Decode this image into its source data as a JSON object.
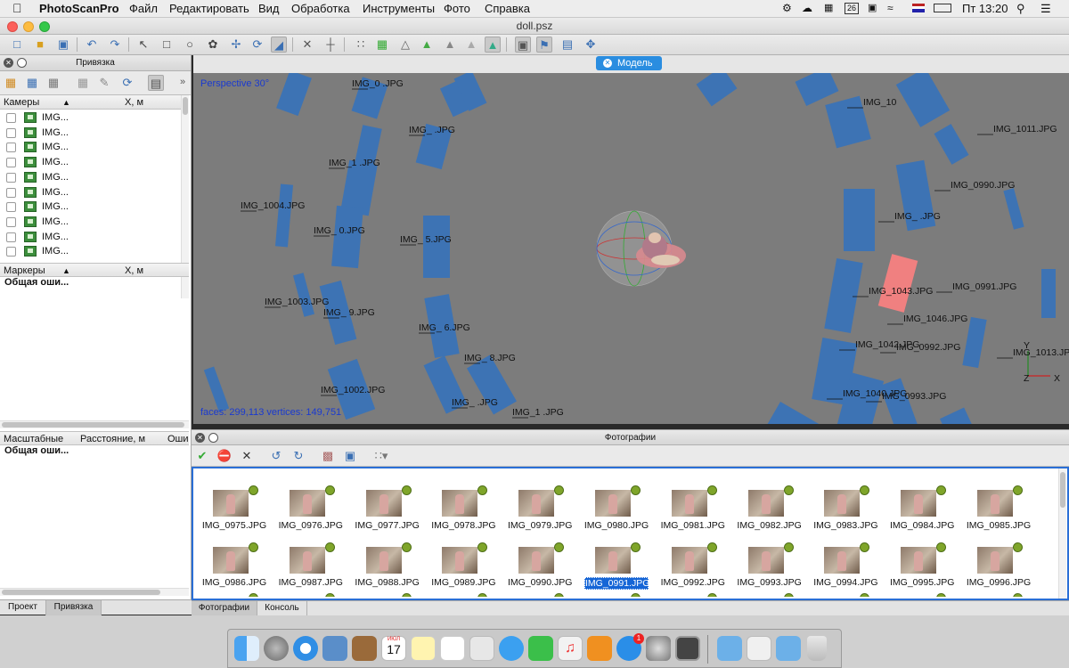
{
  "menubar": {
    "app": "PhotoScanPro",
    "items": [
      "Файл",
      "Редактировать",
      "Вид",
      "Обработка",
      "Инструменты",
      "Фото",
      "Справка"
    ],
    "battery_badge": "26",
    "clock": "Пт 13:20"
  },
  "window": {
    "title": "doll.psz"
  },
  "reference_panel": {
    "title": "Привязка",
    "cameras_col": "Камеры",
    "x_col": "X, м",
    "camera_rows": [
      "IMG...",
      "IMG...",
      "IMG...",
      "IMG...",
      "IMG...",
      "IMG...",
      "IMG...",
      "IMG...",
      "IMG...",
      "IMG..."
    ],
    "markers_col": "Маркеры",
    "markers_x_col": "X, м",
    "markers_total": "Общая оши...",
    "scale_col": "Масштабные",
    "scale_dist_col": "Расстояние, м",
    "scale_err_col": "Оши",
    "scale_total": "Общая оши...",
    "tabs": [
      "Проект",
      "Привязка"
    ]
  },
  "model_tab": {
    "label": "Модель"
  },
  "viewport": {
    "projection": "Perspective 30°",
    "stats": "faces: 299,113 vertices: 149,751",
    "axis_y": "Y",
    "axis_z": "Z",
    "axis_x": "X",
    "camera_labels": [
      "IMG_0  .JPG",
      "IMG_1  .JPG",
      "IMG_   .JPG",
      "IMG_1004.JPG",
      "IMG_   0.JPG",
      "IMG_  5.JPG",
      "IMG_1003.JPG",
      "IMG_  9.JPG",
      "IMG_  6.JPG",
      "IMG_   8.JPG",
      "IMG_1002.JPG",
      "IMG_   .JPG",
      "IMG_1  .JPG",
      "IMG_10  ",
      "IMG_1011.JPG",
      "IMG_0990.JPG",
      "IMG_   .JPG",
      "IMG_1043.JPG",
      "IMG_0991.JPG",
      "IMG_1046.JPG",
      "IMG_1042.JPG",
      "IMG_0992.JPG",
      "IMG_1013.JPG",
      "IMG_1040.JPG",
      "IMG_0993.JPG"
    ]
  },
  "photos_panel": {
    "title": "Фотографии",
    "tabs": [
      "Фотографии",
      "Консоль"
    ],
    "selected": "IMG_0991.JPG",
    "photos": [
      "IMG_0975.JPG",
      "IMG_0976.JPG",
      "IMG_0977.JPG",
      "IMG_0978.JPG",
      "IMG_0979.JPG",
      "IMG_0980.JPG",
      "IMG_0981.JPG",
      "IMG_0982.JPG",
      "IMG_0983.JPG",
      "IMG_0984.JPG",
      "IMG_0985.JPG",
      "IMG_0986.JPG",
      "IMG_0987.JPG",
      "IMG_0988.JPG",
      "IMG_0989.JPG",
      "IMG_0990.JPG",
      "IMG_0991.JPG",
      "IMG_0992.JPG",
      "IMG_0993.JPG",
      "IMG_0994.JPG",
      "IMG_0995.JPG",
      "IMG_0996.JPG"
    ]
  },
  "dock": {
    "calendar_day": "17",
    "calendar_month": "ИЮЛ",
    "appstore_badge": "1"
  },
  "colors": {
    "camera_blue": "#3d73b4",
    "selected_camera": "#f08080",
    "viewport_bg": "#7c7c7c",
    "accent": "#2a6fd6"
  }
}
